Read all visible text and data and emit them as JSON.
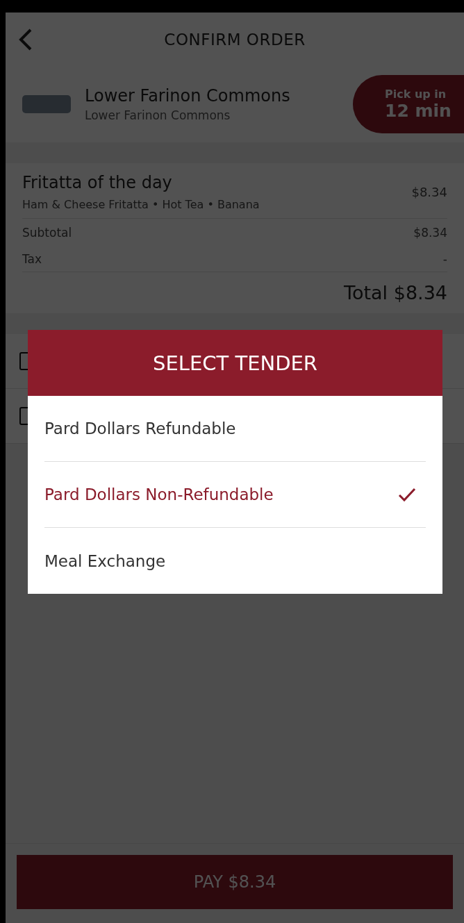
{
  "header": {
    "title": "CONFIRM ORDER"
  },
  "location": {
    "name": "Lower Farinon Commons",
    "subtitle": "Lower Farinon Commons",
    "pickup_label": "Pick up in",
    "pickup_time": "12 min"
  },
  "order": {
    "item": {
      "name": "Fritatta of the day",
      "details": "Ham & Cheese Fritatta • Hot Tea • Banana",
      "price": "$8.34"
    },
    "subtotal": {
      "label": "Subtotal",
      "value": "$8.34"
    },
    "tax": {
      "label": "Tax",
      "value": "-"
    },
    "total": "Total $8.34"
  },
  "pay_button": "PAY $8.34",
  "dialog": {
    "title": "SELECT TENDER",
    "options": [
      {
        "label": "Pard Dollars Refundable",
        "selected": false
      },
      {
        "label": "Pard Dollars Non-Refundable",
        "selected": true
      },
      {
        "label": "Meal Exchange",
        "selected": false
      }
    ]
  }
}
